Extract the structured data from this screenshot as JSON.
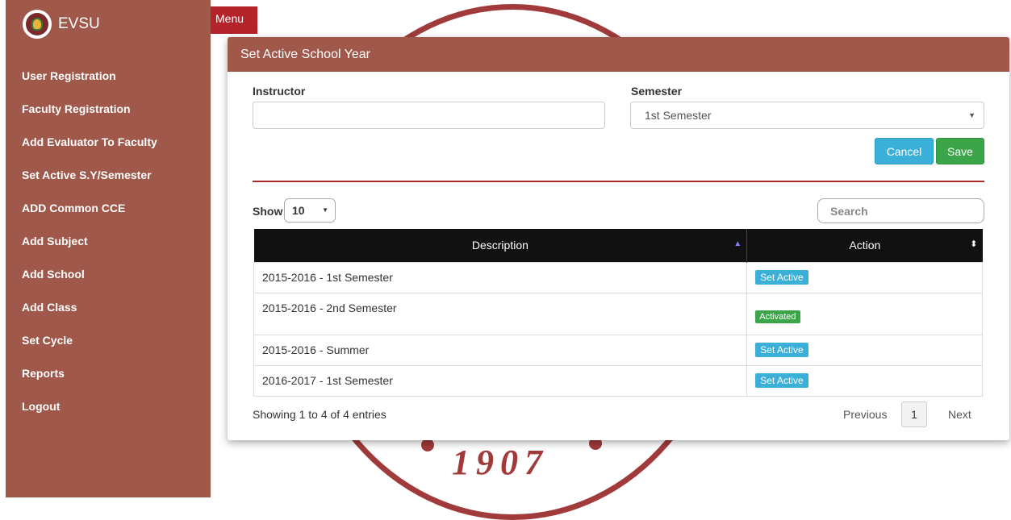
{
  "sidebar": {
    "brand": "EVSU",
    "items": [
      {
        "label": "User Registration"
      },
      {
        "label": "Faculty Registration"
      },
      {
        "label": "Add Evaluator To Faculty"
      },
      {
        "label": "Set Active S.Y/Semester"
      },
      {
        "label": "ADD Common CCE"
      },
      {
        "label": "Add Subject"
      },
      {
        "label": "Add School"
      },
      {
        "label": "Add Class"
      },
      {
        "label": "Set Cycle"
      },
      {
        "label": "Reports"
      },
      {
        "label": "Logout"
      }
    ]
  },
  "background": {
    "seal_year": "1907"
  },
  "menu_button": "Menu",
  "panel": {
    "title": "Set Active School Year",
    "instructor_label": "Instructor",
    "instructor_value": "",
    "semester_label": "Semester",
    "semester_value": "1st Semester",
    "cancel_label": "Cancel",
    "save_label": "Save"
  },
  "table": {
    "show_label": "Show",
    "page_length": "10",
    "search_placeholder": "Search",
    "headers": {
      "description": "Description",
      "action": "Action"
    },
    "rows": [
      {
        "description": "2015-2016 - 1st Semester",
        "action": "Set Active"
      },
      {
        "description": "2015-2016 - 2nd Semester",
        "action": "Activated"
      },
      {
        "description": "2015-2016 - Summer",
        "action": "Set Active"
      },
      {
        "description": "2016-2017 - 1st Semester",
        "action": "Set Active"
      }
    ],
    "info": "Showing 1 to 4 of 4 entries",
    "previous": "Previous",
    "page": "1",
    "next": "Next"
  },
  "colors": {
    "sidebar": "#a0584a",
    "menu_button": "#b3232a",
    "cancel": "#3ab0d9",
    "save": "#3ca54a",
    "table_header": "#111111"
  }
}
